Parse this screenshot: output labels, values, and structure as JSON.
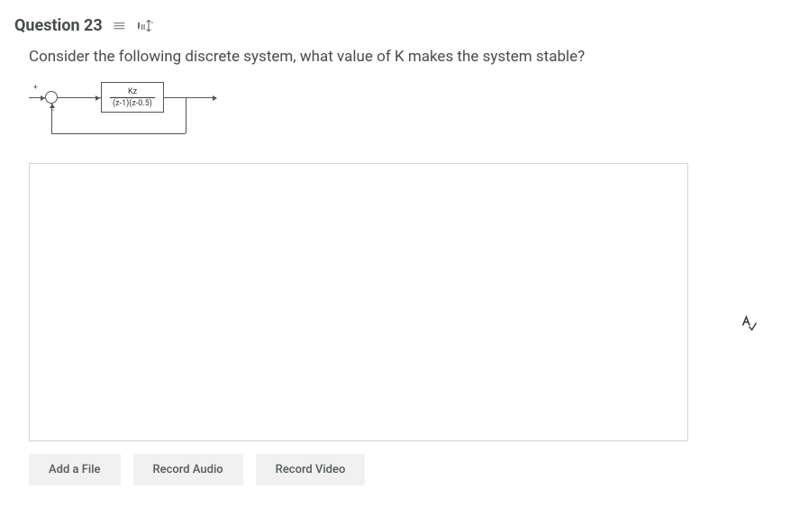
{
  "header": {
    "title": "Question 23"
  },
  "question": {
    "prompt": "Consider the following discrete system, what value of K makes the system stable?",
    "tf_numerator": "Kz",
    "tf_denominator": "(z-1)(z-0.5)"
  },
  "actions": {
    "add_file": "Add a File",
    "record_audio": "Record Audio",
    "record_video": "Record Video"
  }
}
